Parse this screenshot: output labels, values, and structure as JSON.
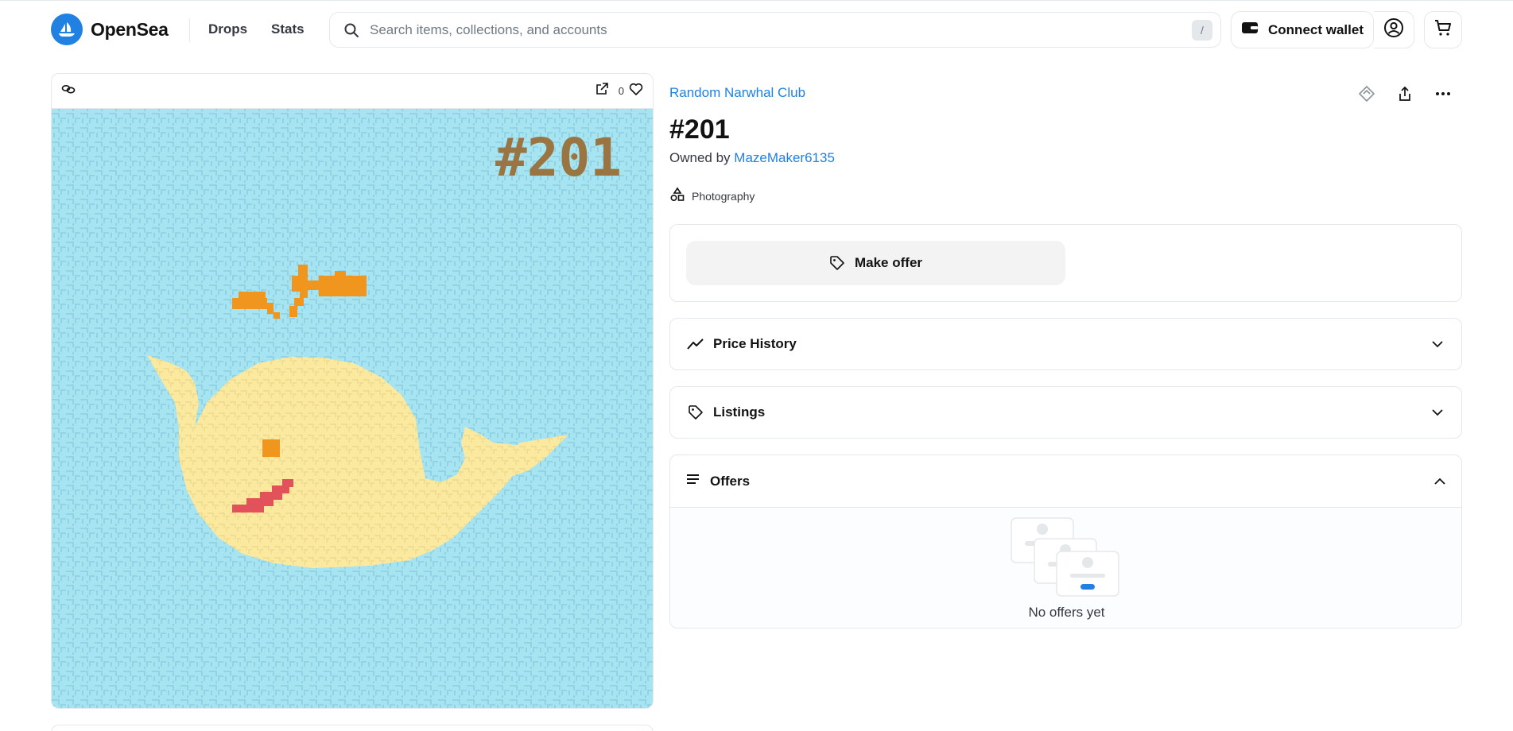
{
  "header": {
    "brand": "OpenSea",
    "nav": [
      "Drops",
      "Stats"
    ],
    "search_placeholder": "Search items, collections, and accounts",
    "search_shortcut": "/",
    "connect_wallet": "Connect wallet"
  },
  "media": {
    "favorite_count": "0",
    "artwork_text": "#201"
  },
  "item": {
    "collection": "Random Narwhal Club",
    "title": "#201",
    "owned_by_label": "Owned by",
    "owner": "MazeMaker6135",
    "category": "Photography"
  },
  "offer": {
    "make_offer_label": "Make offer"
  },
  "sections": {
    "price_history": "Price History",
    "listings": "Listings",
    "offers": "Offers",
    "no_offers": "No offers yet"
  },
  "colors": {
    "accent": "#2081e2",
    "art_bg": "#a6e4f2",
    "whale": "#fbe9a0",
    "spout": "#f0961e",
    "mouth": "#e2525b",
    "number": "#9a7541"
  }
}
